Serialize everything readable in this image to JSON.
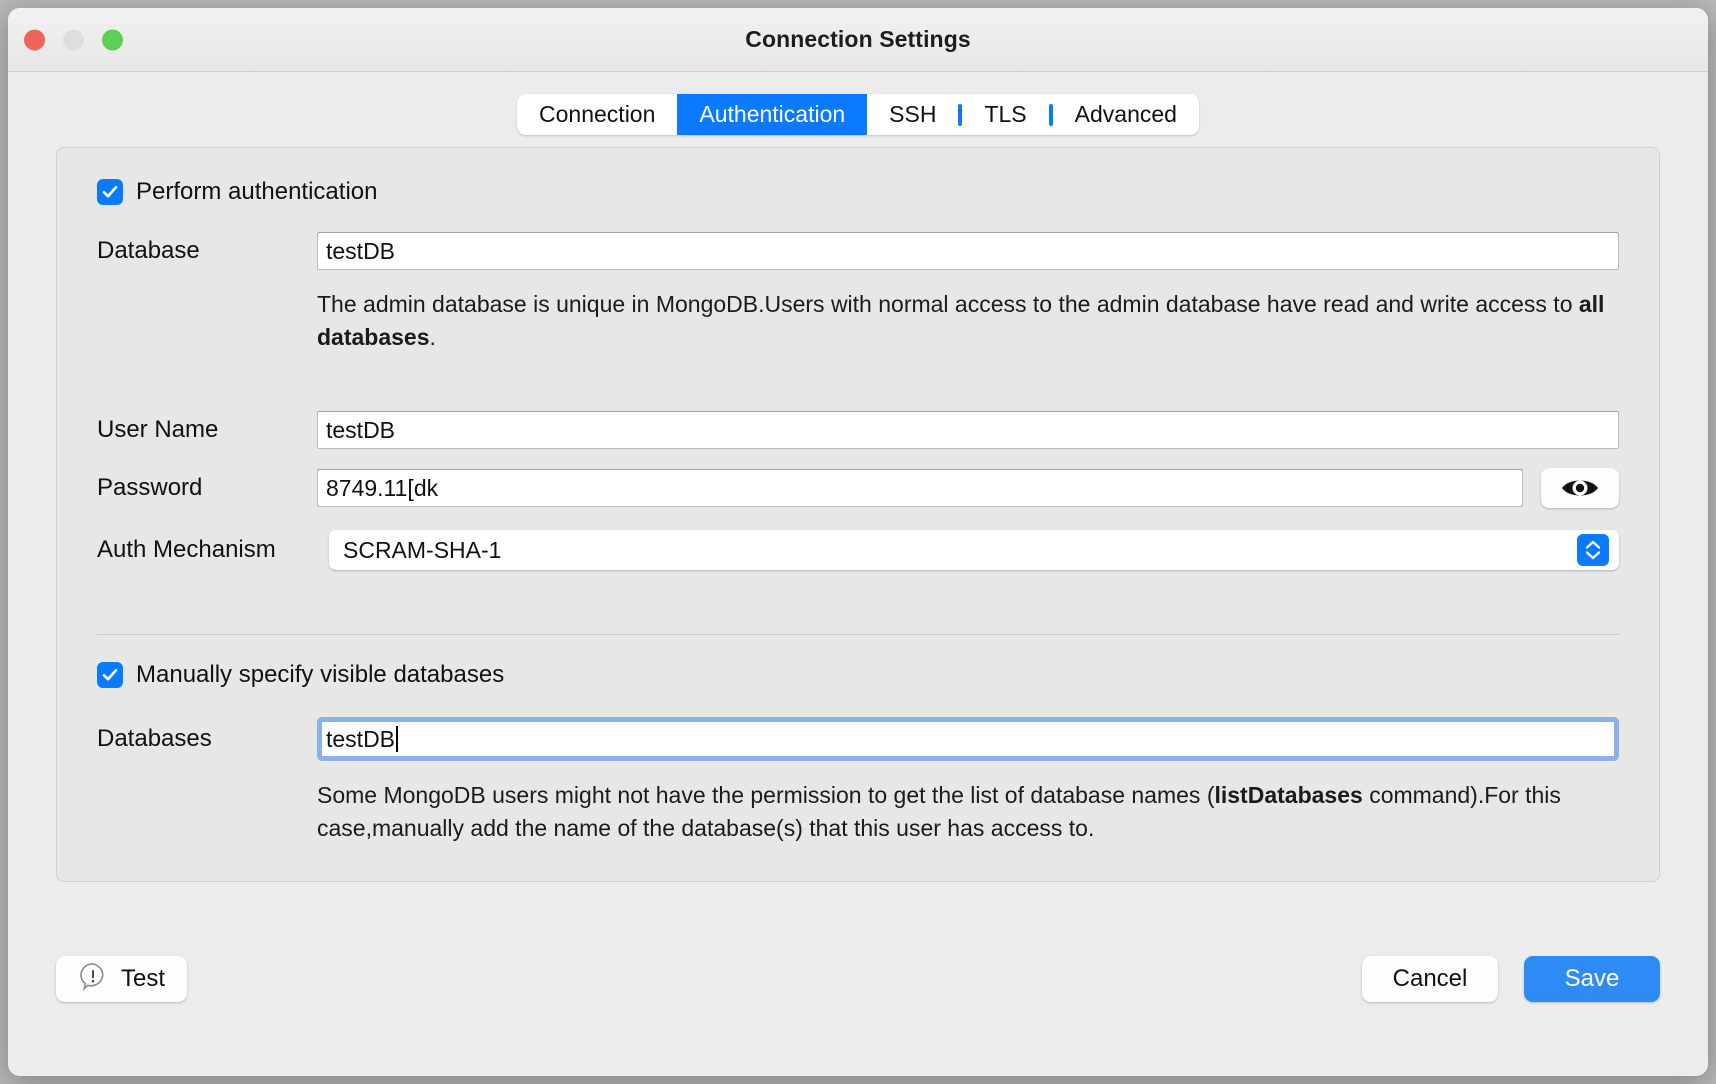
{
  "window": {
    "title": "Connection Settings",
    "traffic_lights": [
      "close-button",
      "minimize-button",
      "maximize-button"
    ],
    "colors": {
      "close": "#f0655a",
      "minimize": "#dedede",
      "maximize": "#5bcf52",
      "accent": "#0a7bff",
      "save_button": "#2e8bf5",
      "panel_bg": "#e7e7e7",
      "window_bg": "#ececec",
      "focus_ring": "#8cb0e8"
    }
  },
  "tabs": [
    {
      "label": "Connection",
      "active": false,
      "separator_after": false
    },
    {
      "label": "Authentication",
      "active": true,
      "separator_after": false
    },
    {
      "label": "SSH",
      "active": false,
      "separator_after": true
    },
    {
      "label": "TLS",
      "active": false,
      "separator_after": true
    },
    {
      "label": "Advanced",
      "active": false,
      "separator_after": false
    }
  ],
  "auth": {
    "perform_authentication": {
      "label": "Perform authentication",
      "checked": true
    },
    "database": {
      "label": "Database",
      "value": "testDB",
      "placeholder": ""
    },
    "database_help": {
      "line1_a": "The admin database is unique in MongoDB.Users with normal access to the admin database have read and",
      "line2_a": "write access to ",
      "line2_bold": "all databases",
      "line2_b": "."
    },
    "user_name": {
      "label": "User Name",
      "value": "testDB",
      "placeholder": ""
    },
    "password": {
      "label": "Password",
      "value": "8749.11[dk",
      "placeholder": "",
      "reveal_icon": "eye-icon"
    },
    "auth_mechanism": {
      "label": "Auth Mechanism",
      "value": "SCRAM-SHA-1",
      "options": [
        "SCRAM-SHA-1"
      ]
    }
  },
  "visible_databases": {
    "checkbox": {
      "label": "Manually specify visible databases",
      "checked": true
    },
    "databases": {
      "label": "Databases",
      "value": "testDB",
      "placeholder": "",
      "focused": true
    },
    "help": {
      "line1_a": "Some MongoDB users might not have the permission to get the list of database names (",
      "line1_bold": "listDatabases",
      "line2_a": "command).For this case,manually add the name of the database(s) that this user has access to."
    }
  },
  "footer": {
    "test_label": "Test",
    "test_icon": "alert-bubble-icon",
    "cancel_label": "Cancel",
    "save_label": "Save"
  }
}
